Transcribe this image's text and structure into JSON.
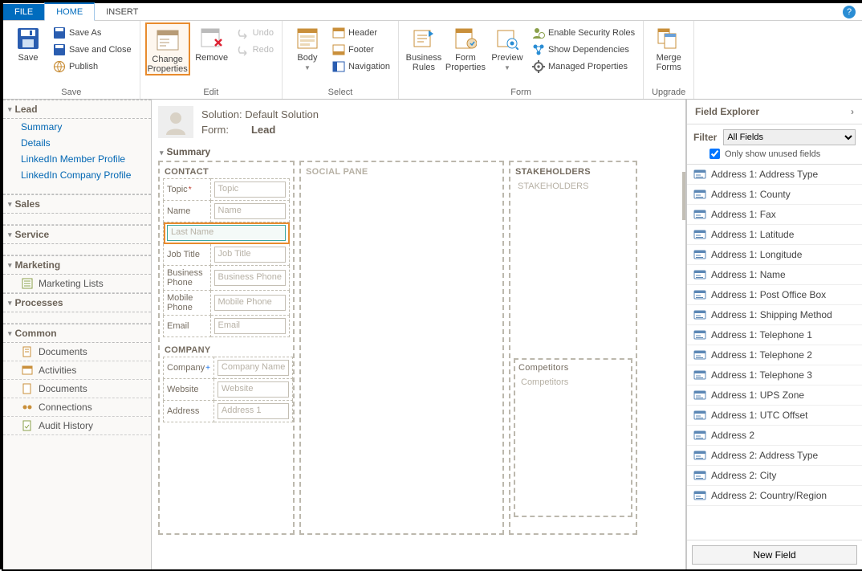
{
  "menubar": {
    "file": "FILE",
    "home": "HOME",
    "insert": "INSERT"
  },
  "ribbon": {
    "save_group": "Save",
    "edit_group": "Edit",
    "select_group": "Select",
    "form_group": "Form",
    "upgrade_group": "Upgrade",
    "save": "Save",
    "save_as": "Save As",
    "save_close": "Save and Close",
    "publish": "Publish",
    "change_properties": "Change Properties",
    "remove": "Remove",
    "undo": "Undo",
    "redo": "Redo",
    "body": "Body",
    "header": "Header",
    "footer": "Footer",
    "navigation": "Navigation",
    "business_rules": "Business Rules",
    "form_properties": "Form Properties",
    "preview": "Preview",
    "enable_security": "Enable Security Roles",
    "show_dependencies": "Show Dependencies",
    "managed_properties": "Managed Properties",
    "merge_forms": "Merge Forms"
  },
  "leftnav": {
    "lead": "Lead",
    "lead_items": [
      "Summary",
      "Details",
      "LinkedIn Member Profile",
      "LinkedIn Company Profile"
    ],
    "sales": "Sales",
    "service": "Service",
    "marketing": "Marketing",
    "marketing_items": [
      "Marketing Lists"
    ],
    "processes": "Processes",
    "common": "Common",
    "common_items": [
      "Documents",
      "Activities",
      "Documents",
      "Connections",
      "Audit History"
    ]
  },
  "solution": {
    "label": "Solution:",
    "name": "Default Solution",
    "form_label": "Form:",
    "form_name": "Lead"
  },
  "summary": {
    "tab_title": "Summary",
    "contact": {
      "title": "CONTACT",
      "fields": {
        "topic": {
          "label": "Topic",
          "ph": "Topic",
          "req": true
        },
        "name": {
          "label": "Name",
          "ph": "Name"
        },
        "lastname": {
          "label": "",
          "ph": "Last Name"
        },
        "jobtitle": {
          "label": "Job Title",
          "ph": "Job Title"
        },
        "bizphone": {
          "label": "Business Phone",
          "ph": "Business Phone"
        },
        "mobile": {
          "label": "Mobile Phone",
          "ph": "Mobile Phone"
        },
        "email": {
          "label": "Email",
          "ph": "Email"
        }
      }
    },
    "company": {
      "title": "COMPANY",
      "fields": {
        "company": {
          "label": "Company",
          "ph": "Company Name",
          "rec": true
        },
        "website": {
          "label": "Website",
          "ph": "Website"
        },
        "address": {
          "label": "Address",
          "ph": "Address 1"
        }
      }
    },
    "social": {
      "title": "SOCIAL PANE"
    },
    "stakeholders": {
      "title": "STAKEHOLDERS",
      "ph": "STAKEHOLDERS"
    },
    "competitors": {
      "title": "Competitors",
      "ph": "Competitors"
    }
  },
  "explorer": {
    "title": "Field Explorer",
    "filter_label": "Filter",
    "filter_options": [
      "All Fields"
    ],
    "only_unused": "Only show unused fields",
    "only_unused_checked": true,
    "fields": [
      "Address 1: Address Type",
      "Address 1: County",
      "Address 1: Fax",
      "Address 1: Latitude",
      "Address 1: Longitude",
      "Address 1: Name",
      "Address 1: Post Office Box",
      "Address 1: Shipping Method",
      "Address 1: Telephone 1",
      "Address 1: Telephone 2",
      "Address 1: Telephone 3",
      "Address 1: UPS Zone",
      "Address 1: UTC Offset",
      "Address 2",
      "Address 2: Address Type",
      "Address 2: City",
      "Address 2: Country/Region"
    ],
    "new_field": "New Field"
  }
}
